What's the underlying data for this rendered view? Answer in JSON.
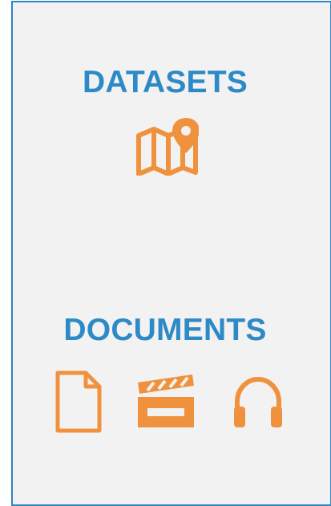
{
  "sections": {
    "datasets": {
      "title": "DATASETS",
      "icons": [
        "map-pin-icon"
      ]
    },
    "documents": {
      "title": "DOCUMENTS",
      "icons": [
        "document-icon",
        "video-clapper-icon",
        "headphones-icon"
      ]
    }
  },
  "colors": {
    "title": "#2e8ac6",
    "icon": "#f0923d",
    "panel_background": "#f2f2f2",
    "panel_border": "#2e86c1"
  }
}
